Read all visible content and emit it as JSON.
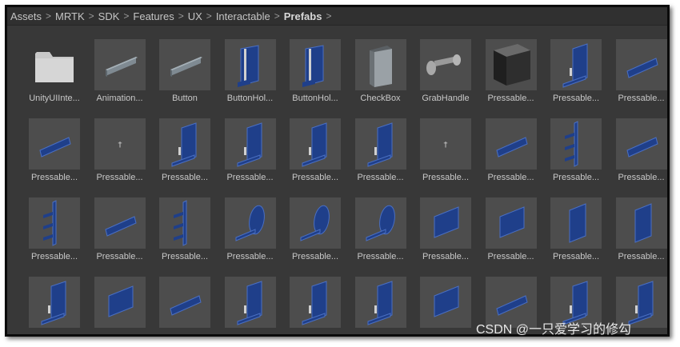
{
  "breadcrumb": {
    "items": [
      "Assets",
      "MRTK",
      "SDK",
      "Features",
      "UX",
      "Interactable",
      "Prefabs"
    ],
    "separator": ">"
  },
  "assets": [
    {
      "label": "UnityUIInte...",
      "icon": "folder-icon"
    },
    {
      "label": "Animation...",
      "icon": "gray-bar-icon"
    },
    {
      "label": "Button",
      "icon": "gray-bar-icon"
    },
    {
      "label": "ButtonHol...",
      "icon": "blue-holder-panel-icon"
    },
    {
      "label": "ButtonHol...",
      "icon": "blue-holder-panel-icon"
    },
    {
      "label": "CheckBox",
      "icon": "gray-checkbox-panel-icon"
    },
    {
      "label": "GrabHandle",
      "icon": "grab-handle-icon"
    },
    {
      "label": "Pressable...",
      "icon": "dark-cube-icon"
    },
    {
      "label": "Pressable...",
      "icon": "blue-panel-stand-icon"
    },
    {
      "label": "Pressable...",
      "icon": "blue-bar-icon"
    },
    {
      "label": "Pressable...",
      "icon": "blue-bar-icon"
    },
    {
      "label": "Pressable...",
      "icon": "tiny-glyph-icon"
    },
    {
      "label": "Pressable...",
      "icon": "blue-panel-stand-icon"
    },
    {
      "label": "Pressable...",
      "icon": "blue-panel-stand-icon"
    },
    {
      "label": "Pressable...",
      "icon": "blue-panel-stand-icon"
    },
    {
      "label": "Pressable...",
      "icon": "blue-panel-stand-icon"
    },
    {
      "label": "Pressable...",
      "icon": "tiny-glyph-icon"
    },
    {
      "label": "Pressable...",
      "icon": "blue-bar-icon"
    },
    {
      "label": "Pressable...",
      "icon": "blue-rack-icon"
    },
    {
      "label": "Pressable...",
      "icon": "blue-bar-icon"
    },
    {
      "label": "Pressable...",
      "icon": "blue-rack-icon"
    },
    {
      "label": "Pressable...",
      "icon": "blue-bar-icon"
    },
    {
      "label": "Pressable...",
      "icon": "blue-rack-icon"
    },
    {
      "label": "Pressable...",
      "icon": "blue-disc-icon"
    },
    {
      "label": "Pressable...",
      "icon": "blue-disc-icon"
    },
    {
      "label": "Pressable...",
      "icon": "blue-disc-icon"
    },
    {
      "label": "Pressable...",
      "icon": "blue-plate-icon"
    },
    {
      "label": "Pressable...",
      "icon": "blue-plate-icon"
    },
    {
      "label": "Pressable...",
      "icon": "blue-tall-plate-icon"
    },
    {
      "label": "Pressable...",
      "icon": "blue-tall-plate-icon"
    },
    {
      "label": "",
      "icon": "blue-panel-stand-icon"
    },
    {
      "label": "",
      "icon": "blue-plate-icon"
    },
    {
      "label": "",
      "icon": "blue-bar-icon"
    },
    {
      "label": "",
      "icon": "blue-panel-stand-icon"
    },
    {
      "label": "",
      "icon": "blue-panel-stand-icon"
    },
    {
      "label": "",
      "icon": "blue-panel-stand-icon"
    },
    {
      "label": "",
      "icon": "blue-plate-icon"
    },
    {
      "label": "",
      "icon": "blue-bar-icon"
    },
    {
      "label": "",
      "icon": "blue-panel-stand-icon"
    },
    {
      "label": "",
      "icon": "blue-panel-stand-icon"
    }
  ],
  "watermark": "CSDN @一只爱学习的修勾",
  "colors": {
    "window_bg": "#383838",
    "thumb_bg": "#4d4d4d",
    "panel_blue": "#1f3f8a",
    "panel_blue_edge": "#4a6fc2",
    "text": "#c8c8c8"
  }
}
